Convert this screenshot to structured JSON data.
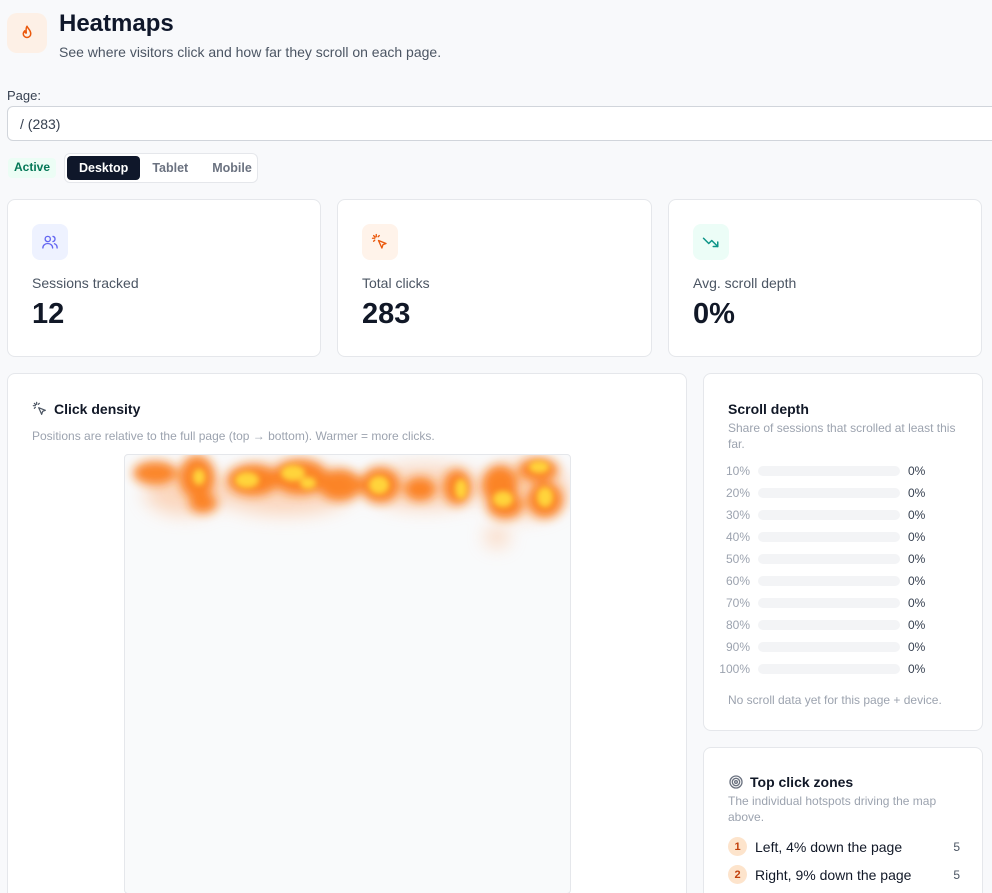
{
  "header": {
    "title": "Heatmaps",
    "subtitle": "See where visitors click and how far they scroll on each page.",
    "icon": "flame-icon"
  },
  "page_picker": {
    "label": "Page:",
    "value": "/ (283)"
  },
  "status_badge": "Active",
  "devices": {
    "options": [
      "Desktop",
      "Tablet",
      "Mobile"
    ],
    "selected": "Desktop"
  },
  "stats": [
    {
      "label": "Sessions tracked",
      "value": "12",
      "icon": "users-icon",
      "accent": "#6366f1"
    },
    {
      "label": "Total clicks",
      "value": "283",
      "icon": "pointer-click-icon",
      "accent": "#ea580c"
    },
    {
      "label": "Avg. scroll depth",
      "value": "0%",
      "icon": "trending-down-icon",
      "accent": "#0d9488"
    }
  ],
  "click_density": {
    "title": "Click density",
    "subtitle": "Positions are relative to the full page (top → bottom). Warmer = more clicks."
  },
  "scroll_depth": {
    "title": "Scroll depth",
    "subtitle": "Share of sessions that scrolled at least this far.",
    "rows": [
      {
        "pct": "10%",
        "value": "0%"
      },
      {
        "pct": "20%",
        "value": "0%"
      },
      {
        "pct": "30%",
        "value": "0%"
      },
      {
        "pct": "40%",
        "value": "0%"
      },
      {
        "pct": "50%",
        "value": "0%"
      },
      {
        "pct": "60%",
        "value": "0%"
      },
      {
        "pct": "70%",
        "value": "0%"
      },
      {
        "pct": "80%",
        "value": "0%"
      },
      {
        "pct": "90%",
        "value": "0%"
      },
      {
        "pct": "100%",
        "value": "0%"
      }
    ],
    "empty_note": "No scroll data yet for this page + device."
  },
  "top_zones": {
    "title": "Top click zones",
    "subtitle": "The individual hotspots driving the map above.",
    "zones": [
      {
        "rank": "1",
        "label": "Left, 4% down the page",
        "count": "5"
      },
      {
        "rank": "2",
        "label": "Right, 9% down the page",
        "count": "5"
      }
    ]
  },
  "colors": {
    "primary": "#0f172a",
    "accent_orange": "#ea580c",
    "success": "#047857"
  }
}
